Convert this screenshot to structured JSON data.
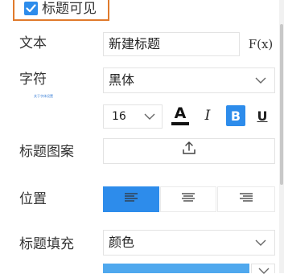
{
  "colors": {
    "checkbox_accent": "#2d8ceb",
    "highlight_border": "#e07a2c",
    "active_blue": "#2d8ceb",
    "fill_swatch": "#4fa8ee"
  },
  "title_visible": {
    "label": "标题可见",
    "checked": true
  },
  "text_row": {
    "label": "文本",
    "value": "新建标题",
    "fx_label": "F(x)"
  },
  "font_row": {
    "label": "字符",
    "value": "黑体",
    "hint": "关于字体设置"
  },
  "style_row": {
    "size_value": "16",
    "color_letter": "A",
    "italic_label": "I",
    "bold_label": "B",
    "underline_label": "U"
  },
  "pattern_row": {
    "label": "标题图案",
    "upload_icon": "upload-icon"
  },
  "position_row": {
    "label": "位置",
    "options": [
      "left-align-icon",
      "center-align-icon",
      "right-align-icon"
    ],
    "selected": 0
  },
  "fill_row": {
    "label": "标题填充",
    "value": "颜色"
  }
}
